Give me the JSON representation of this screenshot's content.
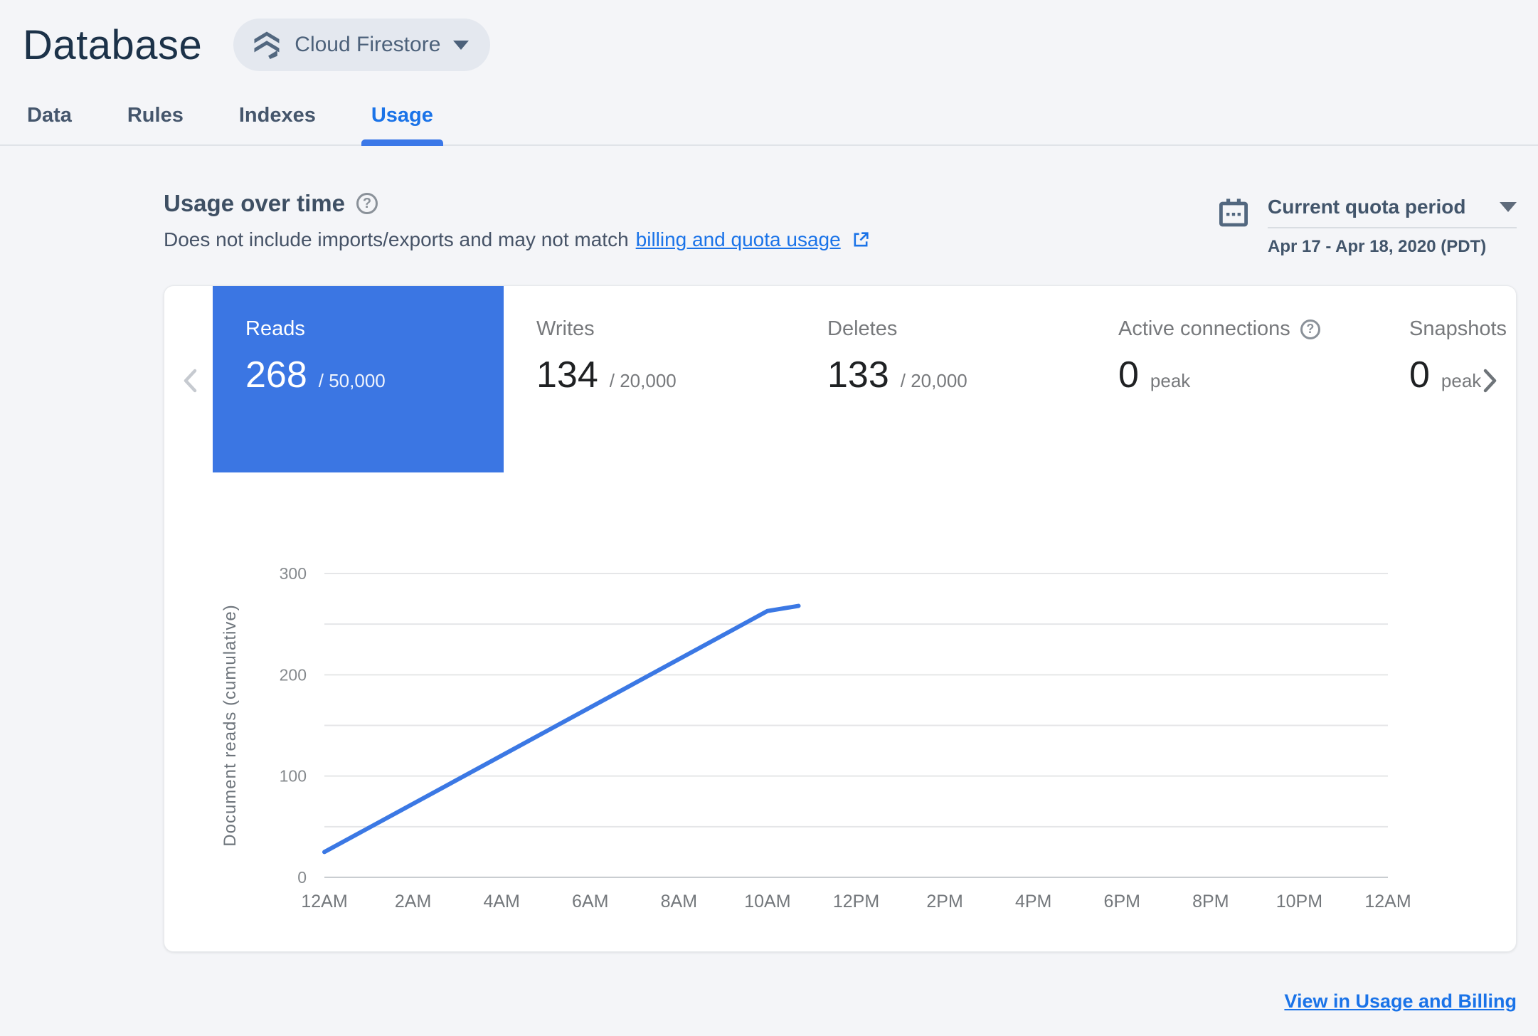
{
  "header": {
    "title": "Database",
    "product_selector_label": "Cloud Firestore"
  },
  "tabs": [
    {
      "label": "Data",
      "active": false
    },
    {
      "label": "Rules",
      "active": false
    },
    {
      "label": "Indexes",
      "active": false
    },
    {
      "label": "Usage",
      "active": true
    }
  ],
  "usage_section": {
    "title": "Usage over time",
    "subtitle_prefix": "Does not include imports/exports and may not match",
    "subtitle_link_text": "billing and quota usage",
    "quota_period": {
      "label": "Current quota period",
      "range": "Apr 17 - Apr 18, 2020 (PDT)"
    }
  },
  "metric_cards": [
    {
      "slug": "reads",
      "label": "Reads",
      "value": "268",
      "suffix": "/ 50,000",
      "selected": true,
      "help": false
    },
    {
      "slug": "writes",
      "label": "Writes",
      "value": "134",
      "suffix": "/ 20,000",
      "selected": false,
      "help": false
    },
    {
      "slug": "deletes",
      "label": "Deletes",
      "value": "133",
      "suffix": "/ 20,000",
      "selected": false,
      "help": false
    },
    {
      "slug": "active-connections",
      "label": "Active connections",
      "value": "0",
      "suffix": "peak",
      "selected": false,
      "help": true
    },
    {
      "slug": "snapshots",
      "label": "Snapshots",
      "value": "0",
      "suffix": "peak",
      "selected": false,
      "help": false
    }
  ],
  "chart_data": {
    "type": "line",
    "ylabel": "Document reads (cumulative)",
    "x_tick_labels": [
      "12AM",
      "2AM",
      "4AM",
      "6AM",
      "8AM",
      "10AM",
      "12PM",
      "2PM",
      "4PM",
      "6PM",
      "8PM",
      "10PM",
      "12AM"
    ],
    "x_range_hours": [
      0,
      24
    ],
    "ylim": [
      0,
      300
    ],
    "y_tick_labels": [
      0,
      100,
      200,
      300
    ],
    "y_gridlines": [
      0,
      50,
      100,
      150,
      200,
      250,
      300
    ],
    "grid": "horizontal",
    "legend": "none",
    "series": [
      {
        "name": "Document reads (cumulative)",
        "color": "#3b78e4",
        "points": [
          {
            "hour": 0,
            "value": 25
          },
          {
            "hour": 10,
            "value": 263
          },
          {
            "hour": 10.7,
            "value": 268
          }
        ]
      }
    ]
  },
  "footer": {
    "link_text": "View in Usage and Billing"
  },
  "colors": {
    "accent_blue": "#1a73e8",
    "selected_card_blue": "#3b76e3",
    "chart_line_blue": "#3b78e4",
    "slate_text": "#44566a",
    "page_background": "#f4f5f8"
  }
}
